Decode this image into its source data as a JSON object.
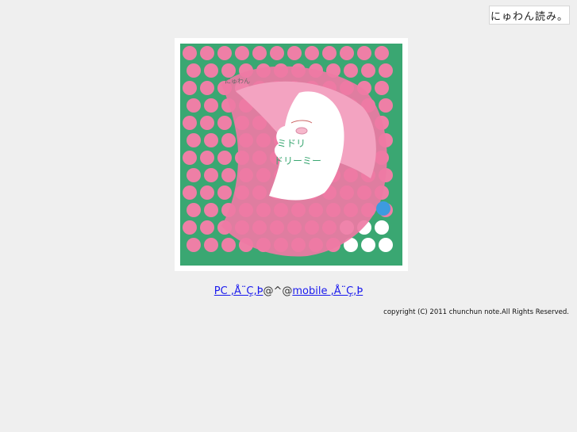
{
  "header": {
    "logo_text": "にゅわん読み。"
  },
  "album": {
    "artist_text": "にゅわん",
    "title_line1": "ミドリ",
    "title_line2": "ドリーミー"
  },
  "links": {
    "pc_label": "PC ,Å¨Ç,Þ",
    "separator": "@^@",
    "mobile_label": "mobile ,Å¨Ç,Þ"
  },
  "footer": {
    "copyright": "copyright (C) 2011 chunchun note.All Rights Reserved."
  },
  "colors": {
    "background": "#efefef",
    "green": "#3aa772",
    "pink_dot": "#ee7fa6",
    "face_pink": "#f2a6c2",
    "link": "#1a1aee"
  }
}
